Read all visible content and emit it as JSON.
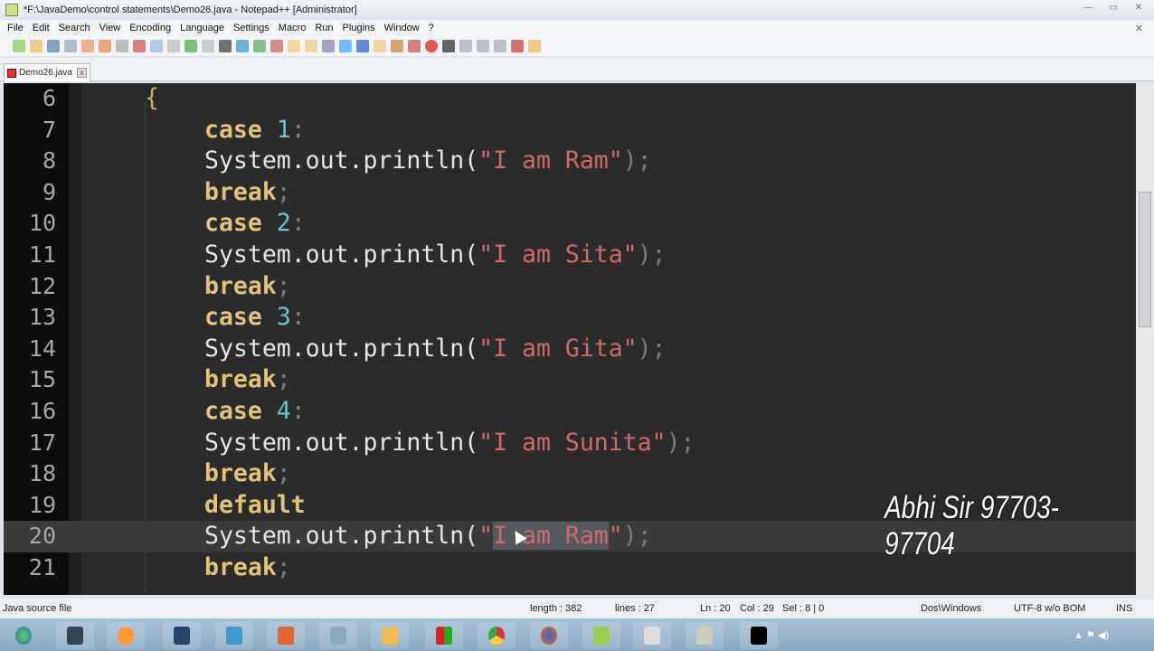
{
  "window": {
    "title": "*F:\\JavaDemo\\control statements\\Demo26.java - Notepad++ [Administrator]"
  },
  "menu": [
    "File",
    "Edit",
    "Search",
    "View",
    "Encoding",
    "Language",
    "Settings",
    "Macro",
    "Run",
    "Plugins",
    "Window",
    "?"
  ],
  "tab": {
    "label": "Demo26.java"
  },
  "editor": {
    "lines": [
      {
        "n": "6"
      },
      {
        "n": "7"
      },
      {
        "n": "8"
      },
      {
        "n": "9"
      },
      {
        "n": "10"
      },
      {
        "n": "11"
      },
      {
        "n": "12"
      },
      {
        "n": "13"
      },
      {
        "n": "14"
      },
      {
        "n": "15"
      },
      {
        "n": "16"
      },
      {
        "n": "17"
      },
      {
        "n": "18"
      },
      {
        "n": "19"
      },
      {
        "n": "20"
      },
      {
        "n": "21"
      }
    ],
    "brace": "{",
    "kw_case": "case",
    "kw_break": "break",
    "kw_default": "default",
    "call": "System.out.println(",
    "nums": [
      "1",
      "2",
      "3",
      "4"
    ],
    "strings": [
      "\"I am Ram\"",
      "\"I am Sita\"",
      "\"I am Gita\"",
      "\"I am Sunita\"",
      "\"I am Ram\""
    ],
    "colon": ":",
    "semi": ";",
    "close": ");",
    "sel_prefix": "\"",
    "selected": "I am Ram",
    "sel_suffix": "\""
  },
  "watermark": "Abhi Sir 97703-97704",
  "status": {
    "type": "Java source file",
    "length": "length : 382",
    "lines": "lines : 27",
    "ln": "Ln : 20",
    "col": "Col : 29",
    "sel": "Sel : 8 | 0",
    "eol": "Dos\\Windows",
    "encoding": "UTF-8 w/o BOM",
    "mode": "INS"
  },
  "colors": {
    "editor_bg": "#2b2b2b",
    "keyword": "#e3c27a",
    "number": "#6fc2c9",
    "string": "#d06a6a"
  }
}
